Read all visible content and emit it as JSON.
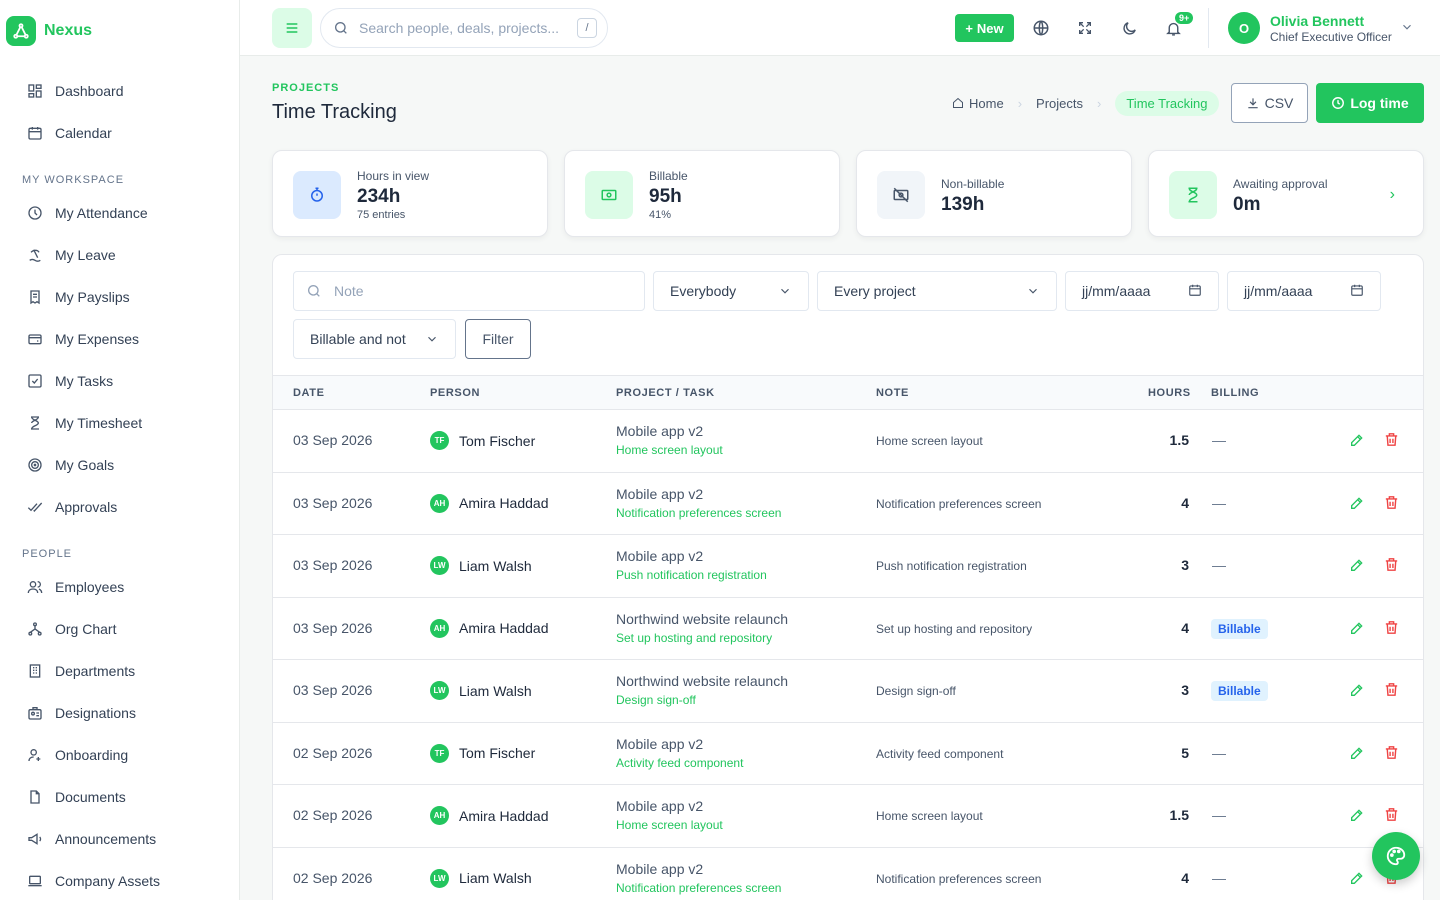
{
  "brand": {
    "name": "Nexus"
  },
  "sidebar": {
    "top_items": [
      {
        "label": "Dashboard",
        "icon": "dashboard-icon"
      },
      {
        "label": "Calendar",
        "icon": "calendar-icon"
      }
    ],
    "sections": [
      {
        "title": "MY WORKSPACE",
        "items": [
          {
            "label": "My Attendance",
            "icon": "clock-icon"
          },
          {
            "label": "My Leave",
            "icon": "beach-icon"
          },
          {
            "label": "My Payslips",
            "icon": "receipt-icon"
          },
          {
            "label": "My Expenses",
            "icon": "wallet-icon"
          },
          {
            "label": "My Tasks",
            "icon": "checkbox-icon"
          },
          {
            "label": "My Timesheet",
            "icon": "hourglass-icon"
          },
          {
            "label": "My Goals",
            "icon": "target-icon"
          },
          {
            "label": "Approvals",
            "icon": "double-check-icon"
          }
        ]
      },
      {
        "title": "PEOPLE",
        "items": [
          {
            "label": "Employees",
            "icon": "users-icon"
          },
          {
            "label": "Org Chart",
            "icon": "hierarchy-icon"
          },
          {
            "label": "Departments",
            "icon": "building-icon"
          },
          {
            "label": "Designations",
            "icon": "id-badge-icon"
          },
          {
            "label": "Onboarding",
            "icon": "user-plus-icon"
          },
          {
            "label": "Documents",
            "icon": "document-icon"
          },
          {
            "label": "Announcements",
            "icon": "megaphone-icon"
          },
          {
            "label": "Company Assets",
            "icon": "laptop-icon"
          }
        ]
      }
    ]
  },
  "topbar": {
    "search_placeholder": "Search people, deals, projects...",
    "search_shortcut": "/",
    "new_label": "New",
    "notif_count": "9+",
    "user_initial": "O",
    "user_name": "Olivia Bennett",
    "user_role": "Chief Executive Officer"
  },
  "page": {
    "eyebrow": "PROJECTS",
    "title": "Time Tracking",
    "breadcrumbs": [
      "Home",
      "Projects",
      "Time Tracking"
    ],
    "csv_label": "CSV",
    "log_label": "Log time"
  },
  "stats": [
    {
      "label": "Hours in view",
      "value": "234h",
      "sub": "75 entries",
      "icon": "stopwatch-icon"
    },
    {
      "label": "Billable",
      "value": "95h",
      "sub": "41%",
      "icon": "cash-icon"
    },
    {
      "label": "Non-billable",
      "value": "139h",
      "sub": "",
      "icon": "cash-off-icon"
    },
    {
      "label": "Awaiting approval",
      "value": "0m",
      "sub": "",
      "icon": "hourglass-icon"
    }
  ],
  "filters": {
    "note_placeholder": "Note",
    "person": "Everybody",
    "project": "Every project",
    "date_from": "jj/mm/aaaa",
    "date_to": "jj/mm/aaaa",
    "billing": "Billable and not",
    "filter_label": "Filter"
  },
  "table": {
    "headers": {
      "date": "DATE",
      "person": "PERSON",
      "project": "PROJECT / TASK",
      "note": "NOTE",
      "hours": "HOURS",
      "billing": "BILLING"
    },
    "rows": [
      {
        "date": "03 Sep 2026",
        "initials": "TF",
        "person": "Tom Fischer",
        "project": "Mobile app v2",
        "task": "Home screen layout",
        "note": "Home screen layout",
        "hours": "1.5",
        "billing": "—"
      },
      {
        "date": "03 Sep 2026",
        "initials": "AH",
        "person": "Amira Haddad",
        "project": "Mobile app v2",
        "task": "Notification preferences screen",
        "note": "Notification preferences screen",
        "hours": "4",
        "billing": "—"
      },
      {
        "date": "03 Sep 2026",
        "initials": "LW",
        "person": "Liam Walsh",
        "project": "Mobile app v2",
        "task": "Push notification registration",
        "note": "Push notification registration",
        "hours": "3",
        "billing": "—"
      },
      {
        "date": "03 Sep 2026",
        "initials": "AH",
        "person": "Amira Haddad",
        "project": "Northwind website relaunch",
        "task": "Set up hosting and repository",
        "note": "Set up hosting and repository",
        "hours": "4",
        "billing": "Billable"
      },
      {
        "date": "03 Sep 2026",
        "initials": "LW",
        "person": "Liam Walsh",
        "project": "Northwind website relaunch",
        "task": "Design sign-off",
        "note": "Design sign-off",
        "hours": "3",
        "billing": "Billable"
      },
      {
        "date": "02 Sep 2026",
        "initials": "TF",
        "person": "Tom Fischer",
        "project": "Mobile app v2",
        "task": "Activity feed component",
        "note": "Activity feed component",
        "hours": "5",
        "billing": "—"
      },
      {
        "date": "02 Sep 2026",
        "initials": "AH",
        "person": "Amira Haddad",
        "project": "Mobile app v2",
        "task": "Home screen layout",
        "note": "Home screen layout",
        "hours": "1.5",
        "billing": "—"
      },
      {
        "date": "02 Sep 2026",
        "initials": "LW",
        "person": "Liam Walsh",
        "project": "Mobile app v2",
        "task": "Notification preferences screen",
        "note": "Notification preferences screen",
        "hours": "4",
        "billing": "—"
      }
    ]
  },
  "colors": {
    "accent": "#22c55e",
    "accent_soft": "#dcfce7",
    "danger": "#ef4444",
    "billable_badge": "#2563eb"
  }
}
